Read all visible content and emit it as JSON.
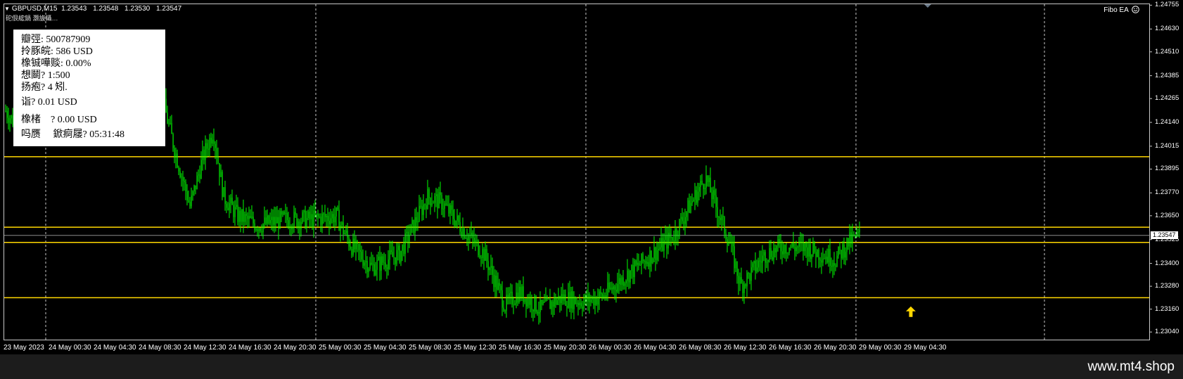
{
  "header": {
    "symbol": "GBPUSD,M15",
    "open": "1.23543",
    "high": "1.23548",
    "low": "1.23530",
    "close": "1.23547",
    "subtitle": "砣佷綋鍋 灏旇鑷…",
    "ea_name": "Fibo EA",
    "ea_icon": "smiley-icon"
  },
  "info_panel": {
    "lines": [
      "瓣弳: 500787909",
      "拎豚皖: 586 USD",
      "橡铖嘩赕: 0.00%",
      "想鬬? 1:500",
      "扬疱? 4 矧.",
      "诣? 0.01 USD",
      "橡楮    ? 0.00 USD",
      "吗赝     鍁痾屦? 05:31:48"
    ]
  },
  "current_price": "1.23547",
  "watermark": "www.mt4.shop",
  "colors": {
    "background": "#000000",
    "candle": "#00ff00",
    "level_line": "#ffd700",
    "current_price_line": "#8a8a8a",
    "arrow": "#ffd700",
    "grid": "#c8c8c8"
  },
  "chart_data": {
    "type": "candlestick",
    "symbol": "GBPUSD",
    "timeframe": "M15",
    "x_tick_labels": [
      "23 May 2023",
      "24 May 00:30",
      "24 May 04:30",
      "24 May 08:30",
      "24 May 12:30",
      "24 May 16:30",
      "24 May 20:30",
      "25 May 00:30",
      "25 May 04:30",
      "25 May 08:30",
      "25 May 12:30",
      "25 May 16:30",
      "25 May 20:30",
      "26 May 00:30",
      "26 May 04:30",
      "26 May 08:30",
      "26 May 12:30",
      "26 May 16:30",
      "26 May 20:30",
      "29 May 00:30",
      "29 May 04:30"
    ],
    "y_tick_labels": [
      "1.24755",
      "1.24630",
      "1.24510",
      "1.24385",
      "1.24265",
      "1.24140",
      "1.24015",
      "1.23895",
      "1.23770",
      "1.23650",
      "1.23525",
      "1.23400",
      "1.23280",
      "1.23160",
      "1.23040"
    ],
    "ylim": [
      1.23,
      1.2476
    ],
    "session_separators": [
      "24 May 00:30",
      "25 May 00:30",
      "26 May 00:30",
      "29 May 00:30",
      "29 May 12:00"
    ],
    "horizontal_levels": [
      1.2396,
      1.2359,
      1.2351,
      1.2322
    ],
    "current_price": 1.23547,
    "arrow_signal": {
      "type": "buy",
      "time": "29 May 04:30",
      "price": 1.232
    },
    "price_path": [
      {
        "t": 0,
        "p": 1.242
      },
      {
        "t": 10,
        "p": 1.2415
      },
      {
        "t": 30,
        "p": 1.2426
      },
      {
        "t": 80,
        "p": 1.2426
      },
      {
        "t": 145,
        "p": 1.2446
      },
      {
        "t": 205,
        "p": 1.2452
      },
      {
        "t": 225,
        "p": 1.2423
      },
      {
        "t": 240,
        "p": 1.24
      },
      {
        "t": 262,
        "p": 1.237
      },
      {
        "t": 280,
        "p": 1.2395
      },
      {
        "t": 295,
        "p": 1.241
      },
      {
        "t": 310,
        "p": 1.2375
      },
      {
        "t": 330,
        "p": 1.2365
      },
      {
        "t": 360,
        "p": 1.236
      },
      {
        "t": 395,
        "p": 1.2363
      },
      {
        "t": 430,
        "p": 1.2363
      },
      {
        "t": 470,
        "p": 1.2365
      },
      {
        "t": 490,
        "p": 1.235
      },
      {
        "t": 520,
        "p": 1.2338
      },
      {
        "t": 560,
        "p": 1.2345
      },
      {
        "t": 600,
        "p": 1.2375
      },
      {
        "t": 620,
        "p": 1.2372
      },
      {
        "t": 650,
        "p": 1.2358
      },
      {
        "t": 680,
        "p": 1.2345
      },
      {
        "t": 710,
        "p": 1.2318
      },
      {
        "t": 730,
        "p": 1.2325
      },
      {
        "t": 760,
        "p": 1.2316
      },
      {
        "t": 790,
        "p": 1.2322
      },
      {
        "t": 820,
        "p": 1.232
      },
      {
        "t": 850,
        "p": 1.2323
      },
      {
        "t": 880,
        "p": 1.2333
      },
      {
        "t": 920,
        "p": 1.2345
      },
      {
        "t": 950,
        "p": 1.2355
      },
      {
        "t": 975,
        "p": 1.2372
      },
      {
        "t": 995,
        "p": 1.2385
      },
      {
        "t": 1015,
        "p": 1.2365
      },
      {
        "t": 1030,
        "p": 1.235
      },
      {
        "t": 1045,
        "p": 1.2328
      },
      {
        "t": 1060,
        "p": 1.2335
      },
      {
        "t": 1080,
        "p": 1.2345
      },
      {
        "t": 1105,
        "p": 1.2349
      },
      {
        "t": 1140,
        "p": 1.2348
      },
      {
        "t": 1180,
        "p": 1.2342
      },
      {
        "t": 1198,
        "p": 1.2351
      },
      {
        "t": 1215,
        "p": 1.23547
      }
    ]
  }
}
